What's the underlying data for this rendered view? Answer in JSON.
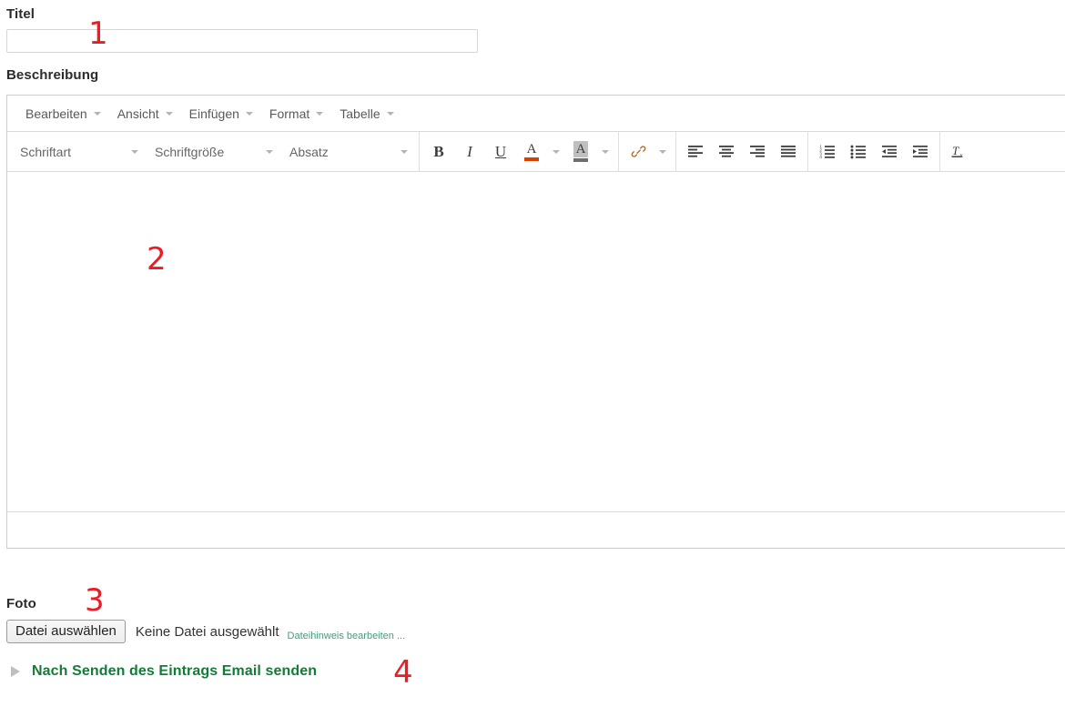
{
  "form": {
    "title_label": "Titel",
    "title_value": "",
    "title_placeholder": "",
    "description_label": "Beschreibung",
    "photo_label": "Foto"
  },
  "editor": {
    "menubar": [
      {
        "label": "Bearbeiten",
        "icon": "chevron-down-icon"
      },
      {
        "label": "Ansicht",
        "icon": "chevron-down-icon"
      },
      {
        "label": "Einfügen",
        "icon": "chevron-down-icon"
      },
      {
        "label": "Format",
        "icon": "chevron-down-icon"
      },
      {
        "label": "Tabelle",
        "icon": "chevron-down-icon"
      }
    ],
    "toolbar": {
      "fontfamily_label": "Schriftart",
      "fontsize_label": "Schriftgröße",
      "paragraph_label": "Absatz",
      "bold_label": "B",
      "italic_label": "I",
      "underline_label": "U",
      "textcolor_label": "A",
      "textcolor_swatch": "#d64000",
      "backcolor_label": "A",
      "backcolor_swatch": "#6e6e6e",
      "link_label": "🔗",
      "align_left_label": "align-left-icon",
      "align_center_label": "align-center-icon",
      "align_right_label": "align-right-icon",
      "align_justify_label": "align-justify-icon",
      "numlist_label": "numbered-list-icon",
      "bullist_label": "bulleted-list-icon",
      "outdent_label": "outdent-icon",
      "indent_label": "indent-icon",
      "removeformat_label": "Tx"
    },
    "content": "",
    "statusbar": ""
  },
  "file": {
    "button_label": "Datei auswählen",
    "status_text": "Keine Datei ausgewählt",
    "hint_link": "Dateihinweis bearbeiten ..."
  },
  "disclosure": {
    "label": "Nach Senden des Eintrags Email senden",
    "triangle_icon": "triangle-right-icon"
  },
  "annotations": [
    {
      "number": "1"
    },
    {
      "number": "2"
    },
    {
      "number": "3"
    },
    {
      "number": "4"
    }
  ],
  "colors": {
    "annotation_red": "#ed1c24",
    "green_heading": "#127c37",
    "green_hint": "#4a9a78",
    "label_dark": "#2b2b2b"
  }
}
